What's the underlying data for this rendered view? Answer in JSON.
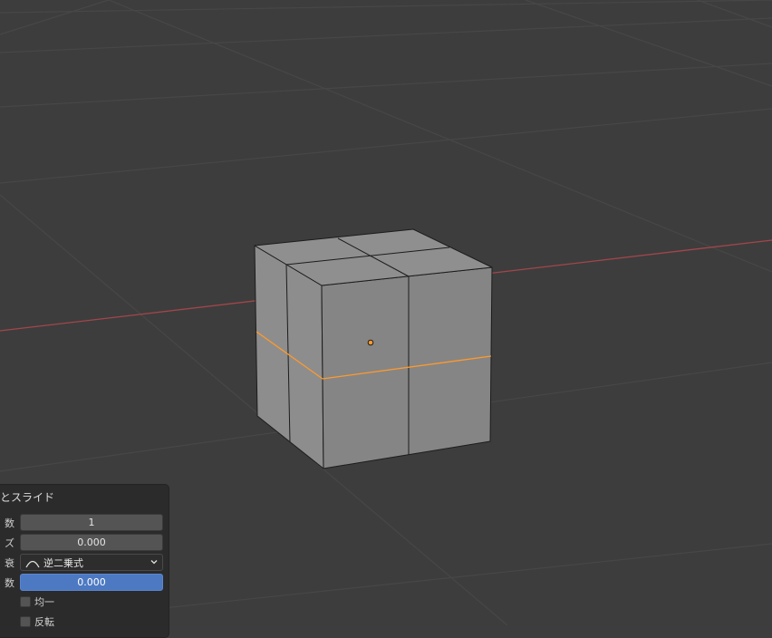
{
  "viewport": {
    "colors": {
      "background": "#3d3d3d",
      "grid": "#484848",
      "x_axis": "#a3464c",
      "mesh_face": "#8a8a8a",
      "mesh_edge": "#1e1e1e",
      "selected_edge": "#ff9a2c",
      "origin": "#ff9a2c"
    }
  },
  "operator_panel": {
    "title": "とスライド",
    "rows": [
      {
        "label": "数",
        "value": "1"
      },
      {
        "label": "ズ",
        "value": "0.000"
      },
      {
        "label": "衰",
        "value": "逆二乗式",
        "icon": "falloff-curve-icon"
      },
      {
        "label": "数",
        "value": "0.000"
      }
    ],
    "checkboxes": [
      {
        "label": "均一",
        "checked": false
      },
      {
        "label": "反転",
        "checked": false
      }
    ]
  }
}
